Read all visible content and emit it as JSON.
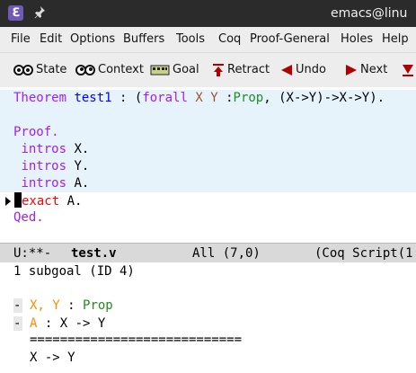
{
  "titlebar": {
    "app_icon": "emacs-icon",
    "pin_icon": "pin-icon",
    "title": "emacs@linu"
  },
  "menu": [
    "File",
    "Edit",
    "Options",
    "Buffers",
    "Tools",
    "Coq",
    "Proof-General",
    "Holes",
    "Help"
  ],
  "toolbar": {
    "state": "State",
    "context": "Context",
    "goal": "Goal",
    "retract": "Retract",
    "undo": "Undo",
    "next": "Next"
  },
  "script": {
    "theorem_kw": "Theorem",
    "theorem_name": "test1",
    "colon": " : (",
    "forall_kw": "forall",
    "var_x": "X",
    "var_y": "Y",
    "prop_colon": " :",
    "prop_type": "Prop",
    "statement_rest": ", (X->Y)->X->Y).",
    "proof_kw": "Proof.",
    "intros1_kw": "intros",
    "intros1_arg": " X.",
    "intros2_kw": "intros",
    "intros2_arg": " Y.",
    "intros3_kw": "intros",
    "intros3_arg": " A.",
    "exact_kw": "exact",
    "exact_arg": " A.",
    "qed_kw": "Qed."
  },
  "modeline": {
    "status": "U:**-",
    "buffer": "test.v",
    "position": "All (7,0)",
    "mode": "(Coq Script(1"
  },
  "goals": {
    "subgoal": "1 subgoal (ID 4)",
    "hyp1_marker": "-",
    "hyp1_names": "X, Y",
    "hyp1_sep": " : ",
    "hyp1_type": "Prop",
    "hyp2_marker": "-",
    "hyp2_name": "A",
    "hyp2_sep": " : ",
    "hyp2_type": "X -> Y",
    "separator": "============================",
    "conclusion": "X -> Y"
  },
  "colors": {
    "keyword": "#a020f0",
    "function_name": "#0000ff",
    "type": "#228b22",
    "variable": "#a0522d",
    "error": "#ff0000",
    "locked_region": "#e6f3fb",
    "hypothesis_name": "#ff8c00"
  }
}
